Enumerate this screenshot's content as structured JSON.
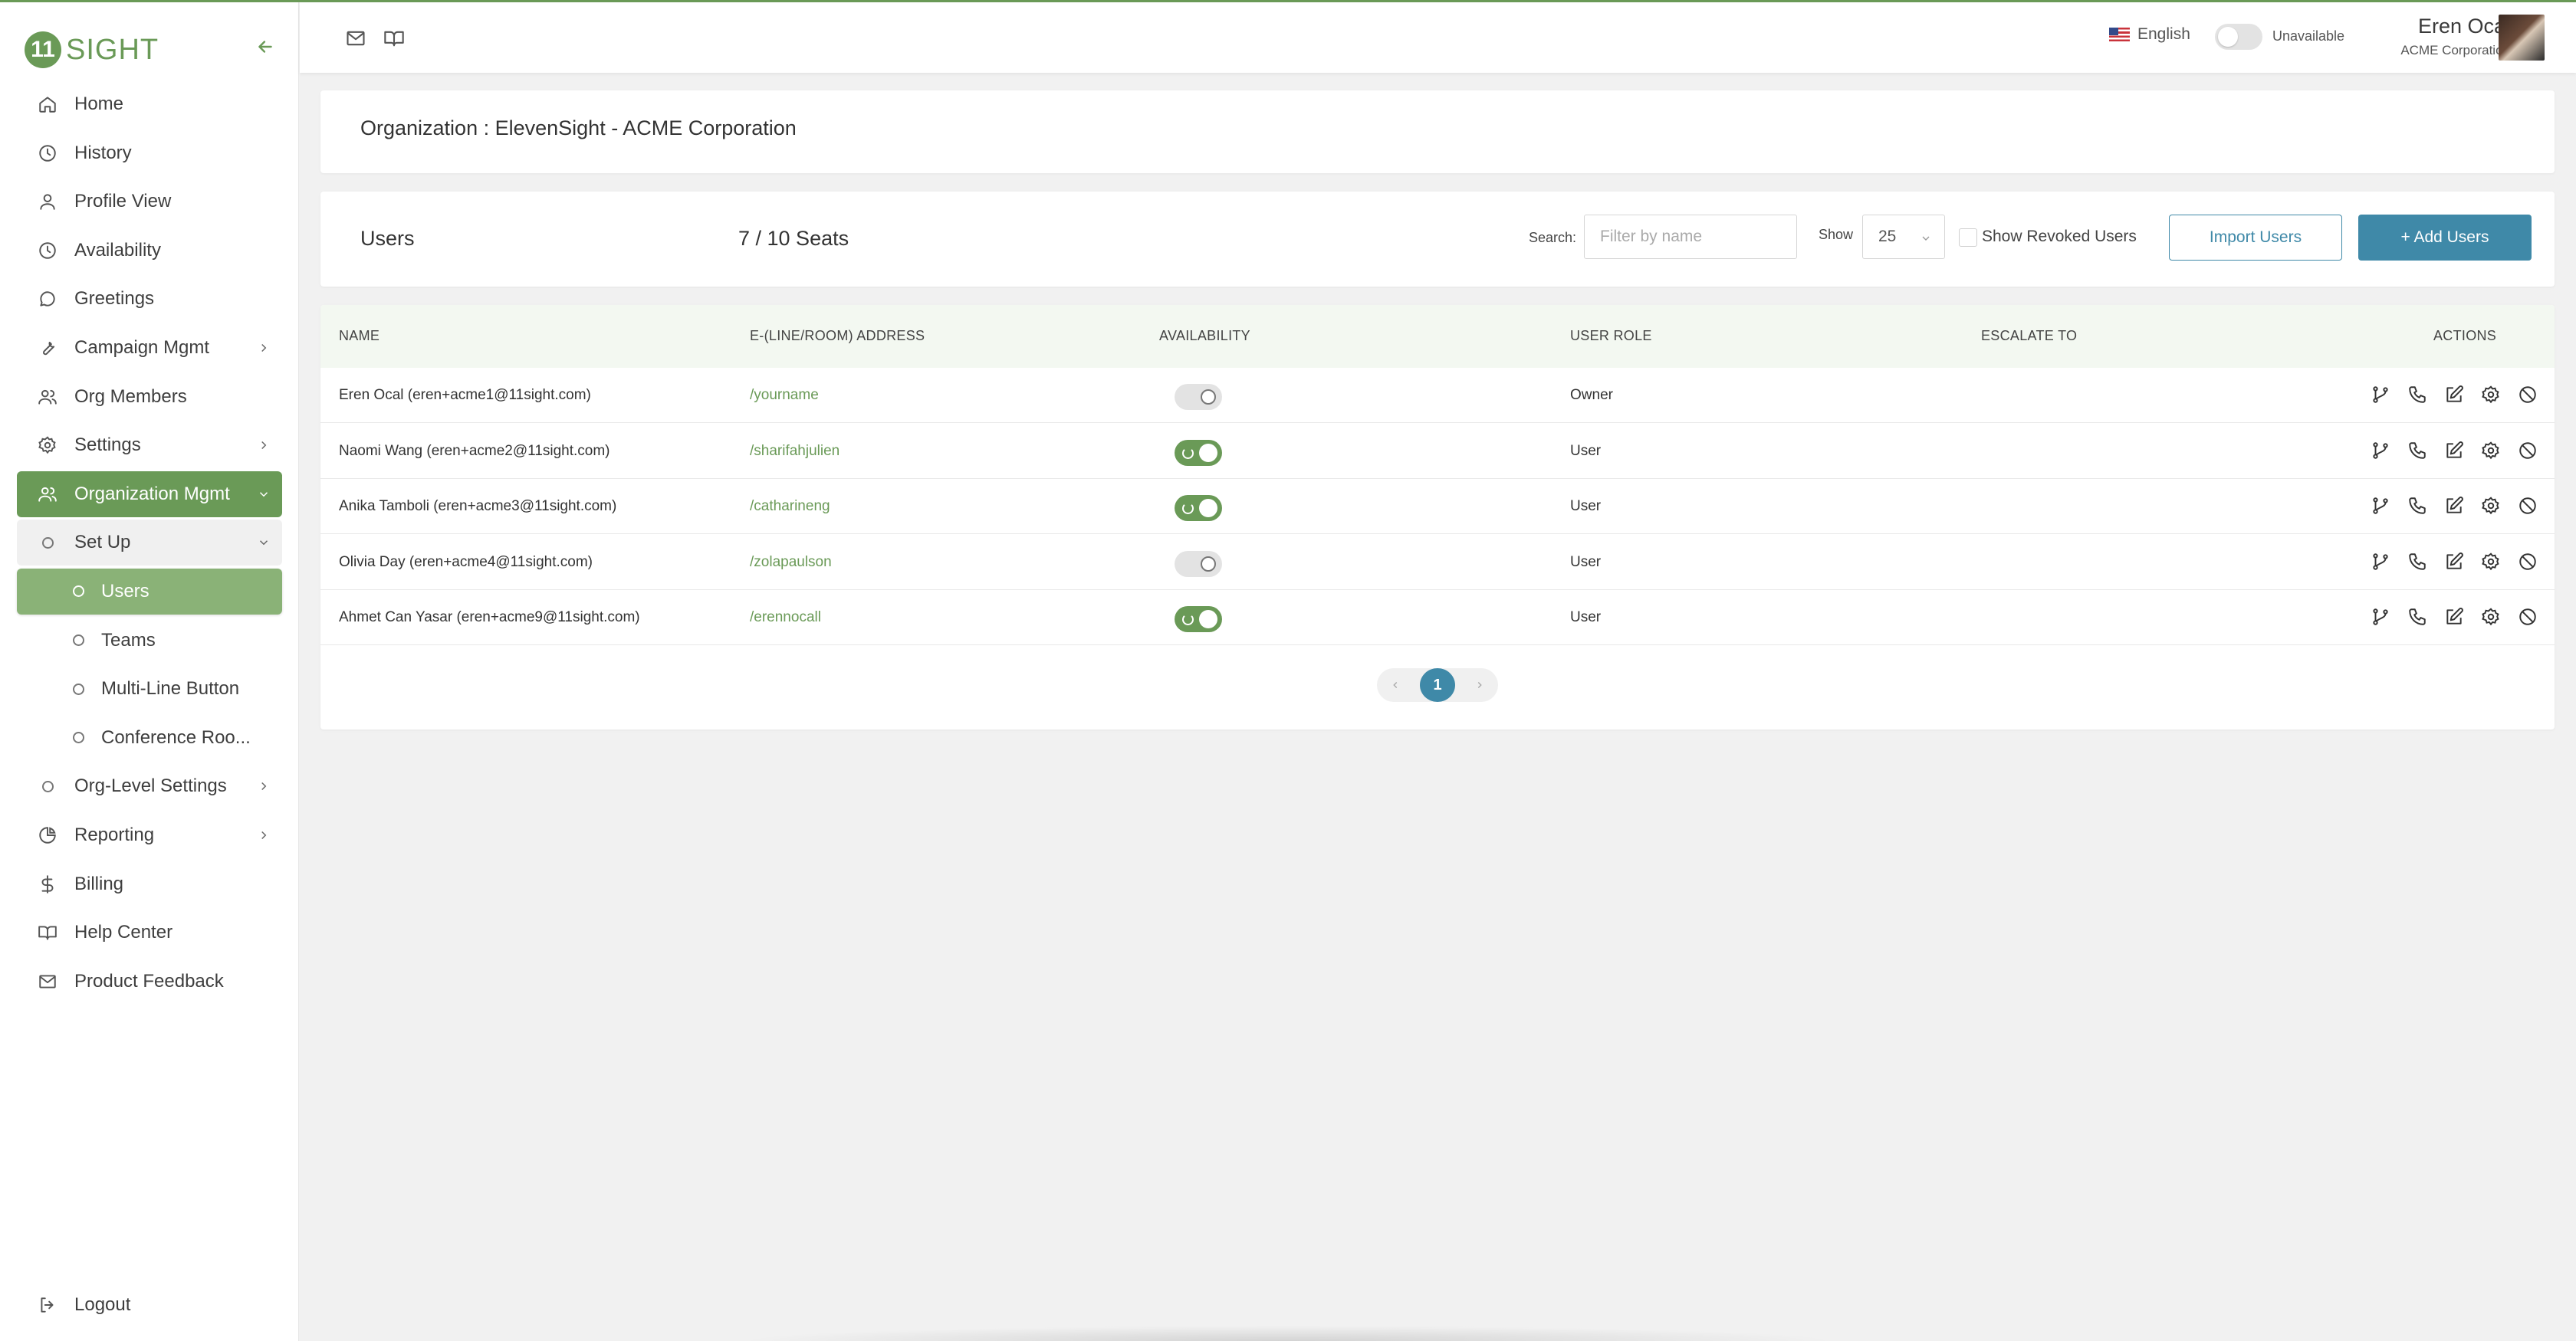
{
  "brand": {
    "name": "SIGHT",
    "mark": "11"
  },
  "sidebar": {
    "items": [
      {
        "label": "Home",
        "icon": "home-icon"
      },
      {
        "label": "History",
        "icon": "clock-icon"
      },
      {
        "label": "Profile View",
        "icon": "user-icon"
      },
      {
        "label": "Availability",
        "icon": "clock-icon"
      },
      {
        "label": "Greetings",
        "icon": "chat-bubble-icon"
      },
      {
        "label": "Campaign Mgmt",
        "icon": "wrench-icon"
      },
      {
        "label": "Org Members",
        "icon": "users-icon"
      },
      {
        "label": "Settings",
        "icon": "gear-icon"
      },
      {
        "label": "Organization Mgmt",
        "icon": "users-icon"
      },
      {
        "label": "Set Up",
        "icon": "circle-icon"
      },
      {
        "label": "Users",
        "icon": "circle-icon"
      },
      {
        "label": "Teams",
        "icon": "circle-icon"
      },
      {
        "label": "Multi-Line Button",
        "icon": "circle-icon"
      },
      {
        "label": "Conference Roo...",
        "icon": "circle-icon"
      },
      {
        "label": "Org-Level Settings",
        "icon": "circle-icon"
      },
      {
        "label": "Reporting",
        "icon": "pie-chart-icon"
      },
      {
        "label": "Billing",
        "icon": "dollar-icon"
      },
      {
        "label": "Help Center",
        "icon": "book-icon"
      },
      {
        "label": "Product Feedback",
        "icon": "mail-icon"
      }
    ],
    "logout": "Logout"
  },
  "header": {
    "language": "English",
    "availability": "Unavailable",
    "user_name": "Eren Ocal",
    "user_org": "ACME Corporation"
  },
  "org": {
    "title": "Organization : ElevenSight - ACME Corporation"
  },
  "users_panel": {
    "title": "Users",
    "seats": "7 / 10 Seats",
    "search_label": "Search:",
    "search_placeholder": "Filter by name",
    "show_label": "Show",
    "show_value": "25",
    "revoked_label": "Show Revoked Users",
    "import_label": "Import Users",
    "add_label": "+ Add Users"
  },
  "table": {
    "columns": [
      "NAME",
      "E-(LINE/ROOM) ADDRESS",
      "AVAILABILITY",
      "USER ROLE",
      "ESCALATE TO",
      "ACTIONS"
    ],
    "rows": [
      {
        "name": "Eren Ocal (eren+acme1@11sight.com)",
        "address": "/yourname",
        "available": false,
        "role": "Owner",
        "escalate": ""
      },
      {
        "name": "Naomi Wang (eren+acme2@11sight.com)",
        "address": "/sharifahjulien",
        "available": true,
        "role": "User",
        "escalate": ""
      },
      {
        "name": "Anika Tamboli (eren+acme3@11sight.com)",
        "address": "/catharineng",
        "available": true,
        "role": "User",
        "escalate": ""
      },
      {
        "name": "Olivia Day (eren+acme4@11sight.com)",
        "address": "/zolapaulson",
        "available": false,
        "role": "User",
        "escalate": ""
      },
      {
        "name": "Ahmet Can Yasar (eren+acme9@11sight.com)",
        "address": "/erennocall",
        "available": true,
        "role": "User",
        "escalate": ""
      }
    ]
  },
  "pager": {
    "current": "1"
  },
  "colors": {
    "brand_green": "#6a9a57",
    "accent_blue": "#3f89a8"
  }
}
